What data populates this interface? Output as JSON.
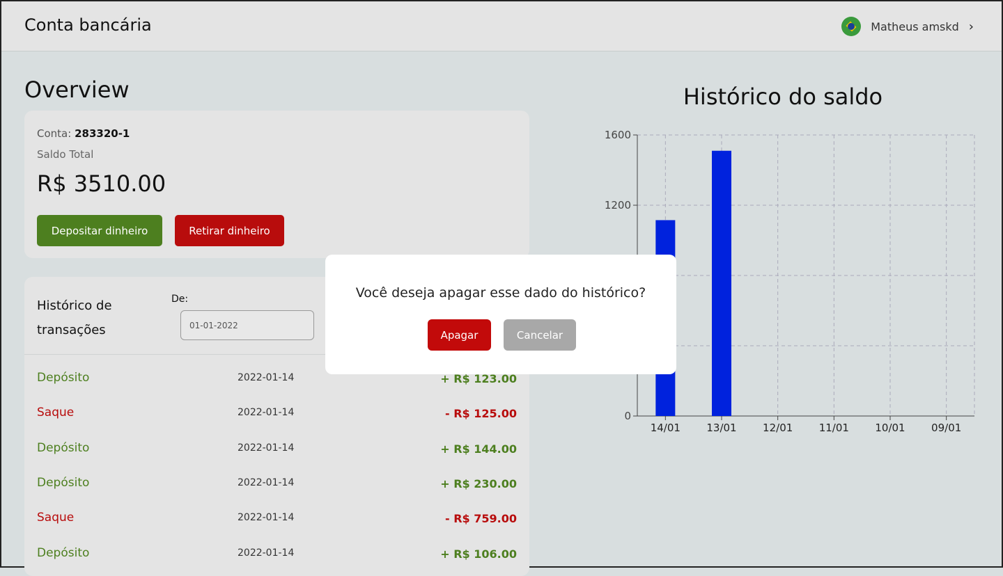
{
  "header": {
    "app_title": "Conta bancária",
    "user_name": "Matheus amskd",
    "flag_icon": "brazil-flag-icon",
    "chevron_icon": "chevron-right-icon"
  },
  "overview": {
    "title": "Overview",
    "account_label": "Conta:",
    "account_number": "283320-1",
    "balance_label": "Saldo Total",
    "balance_value": "R$ 3510.00",
    "deposit_button": "Depositar dinheiro",
    "withdraw_button": "Retirar dinheiro"
  },
  "transactions": {
    "title": "Histórico de transações",
    "from_label": "De:",
    "from_date": "01-01-2022",
    "rows": [
      {
        "type": "Depósito",
        "kind": "dep",
        "date": "2022-01-14",
        "amount": "+ R$ 123.00"
      },
      {
        "type": "Saque",
        "kind": "saq",
        "date": "2022-01-14",
        "amount": "- R$ 125.00"
      },
      {
        "type": "Depósito",
        "kind": "dep",
        "date": "2022-01-14",
        "amount": "+ R$ 144.00"
      },
      {
        "type": "Depósito",
        "kind": "dep",
        "date": "2022-01-14",
        "amount": "+ R$ 230.00"
      },
      {
        "type": "Saque",
        "kind": "saq",
        "date": "2022-01-14",
        "amount": "- R$ 759.00"
      },
      {
        "type": "Depósito",
        "kind": "dep",
        "date": "2022-01-14",
        "amount": "+ R$ 106.00"
      }
    ]
  },
  "modal": {
    "message": "Você deseja apagar esse dado do histórico?",
    "confirm_button": "Apagar",
    "cancel_button": "Cancelar"
  },
  "chart_data": {
    "type": "bar",
    "title": "Histórico do saldo",
    "categories": [
      "14/01",
      "13/01",
      "12/01",
      "11/01",
      "10/01",
      "09/01"
    ],
    "values": [
      1115,
      1510,
      0,
      0,
      0,
      0
    ],
    "ylim": [
      0,
      1600
    ],
    "yticks": [
      0,
      1200,
      1600
    ],
    "grid": true,
    "bar_color": "#0022dd"
  }
}
